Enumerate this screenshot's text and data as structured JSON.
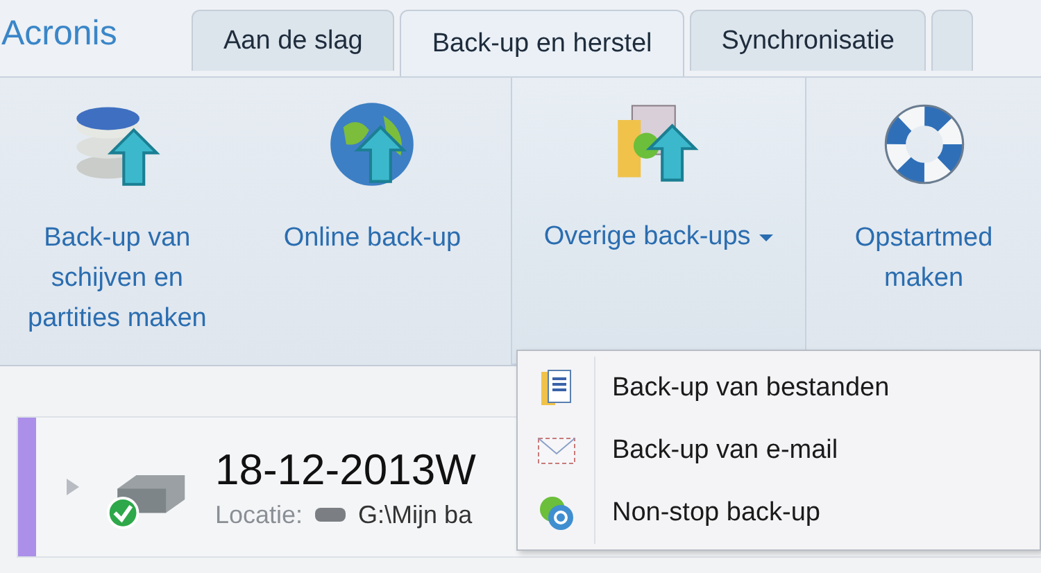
{
  "logo": "Acronis",
  "tabs": [
    {
      "label": "Aan de slag",
      "selected": false
    },
    {
      "label": "Back-up en herstel",
      "selected": true
    },
    {
      "label": "Synchronisatie",
      "selected": false
    },
    {
      "selected": false
    }
  ],
  "ribbon": [
    {
      "kind": "disks",
      "lines": [
        "Back-up van",
        "schijven en",
        "partities maken"
      ],
      "selected": false,
      "has_menu": false
    },
    {
      "kind": "globe",
      "lines": [
        "Online back-up"
      ],
      "selected": false,
      "has_menu": false
    },
    {
      "kind": "other",
      "lines": [
        "Overige back-ups"
      ],
      "selected": true,
      "has_menu": true
    },
    {
      "kind": "lifebuoy",
      "lines": [
        "Opstartmed",
        "maken"
      ],
      "selected": false,
      "has_menu": false
    }
  ],
  "backup": {
    "title": "18-12-2013W",
    "location_label": "Locatie:",
    "location": "G:\\Mijn ba",
    "backed_up": true
  },
  "menu": [
    {
      "kind": "files",
      "label": "Back-up van bestanden"
    },
    {
      "kind": "email",
      "label": "Back-up van e-mail"
    },
    {
      "kind": "nonstop",
      "label": "Non-stop back-up"
    }
  ]
}
